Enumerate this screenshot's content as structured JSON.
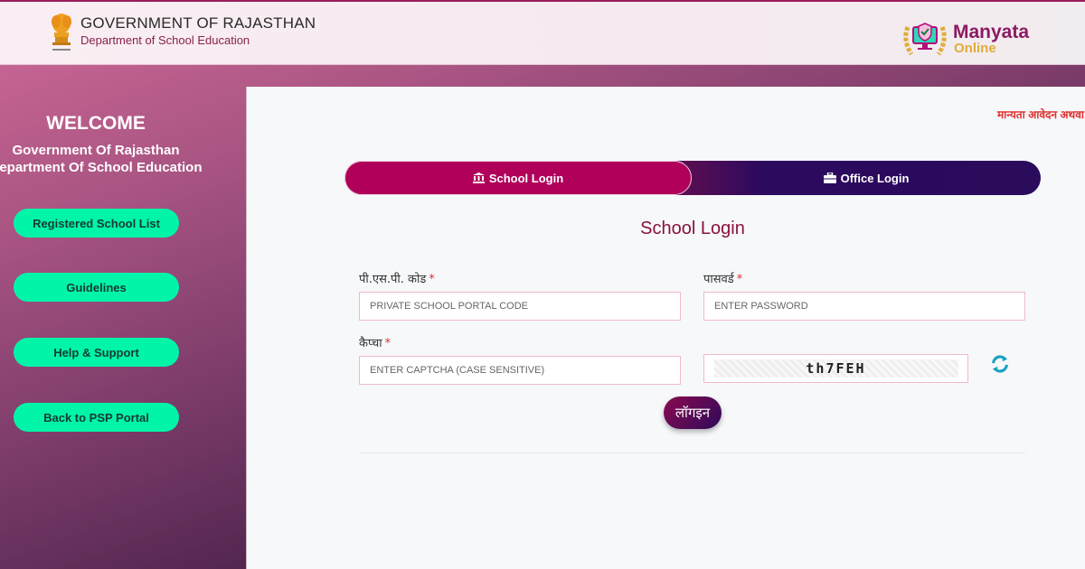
{
  "header": {
    "gov_title": "GOVERNMENT OF RAJASTHAN",
    "gov_subtitle": "Department of School Education",
    "emblem_icon": "national-emblem-icon",
    "brand_name": "Manyata",
    "brand_sub": "Online",
    "brand_icon": "certified-monitor-laurel-icon"
  },
  "sidebar": {
    "welcome": "WELCOME",
    "line1": "Government Of Rajasthan",
    "line2": "Department Of School Education",
    "buttons": [
      {
        "label": "Registered School List"
      },
      {
        "label": "Guidelines"
      },
      {
        "label": "Help & Support"
      },
      {
        "label": "Back to PSP Portal"
      }
    ]
  },
  "main": {
    "marquee": "मान्यता आवेदन अथवा",
    "tabs": [
      {
        "label": "School Login",
        "icon": "bank-icon",
        "active": true
      },
      {
        "label": "Office Login",
        "icon": "briefcase-icon",
        "active": false
      }
    ],
    "form_title": "School Login",
    "fields": {
      "psp_code": {
        "label": "पी.एस.पी. कोड",
        "required": "*",
        "placeholder": "PRIVATE SCHOOL PORTAL CODE",
        "value": ""
      },
      "password": {
        "label": "पासवर्ड",
        "required": "*",
        "placeholder": "ENTER PASSWORD",
        "value": ""
      },
      "captcha": {
        "label": "कैप्चा",
        "required": "*",
        "placeholder": "ENTER CAPTCHA (CASE SENSITIVE)",
        "value": ""
      }
    },
    "captcha_text": "th7FEH",
    "refresh_icon": "refresh-icon",
    "login_label": "लॉगइन"
  },
  "colors": {
    "accent_primary": "#b0005a",
    "accent_dark": "#2c0a5e",
    "sidebar_button": "#00f5a8",
    "title_color": "#8a1040",
    "required": "#e03030",
    "marquee": "#e0302f"
  }
}
